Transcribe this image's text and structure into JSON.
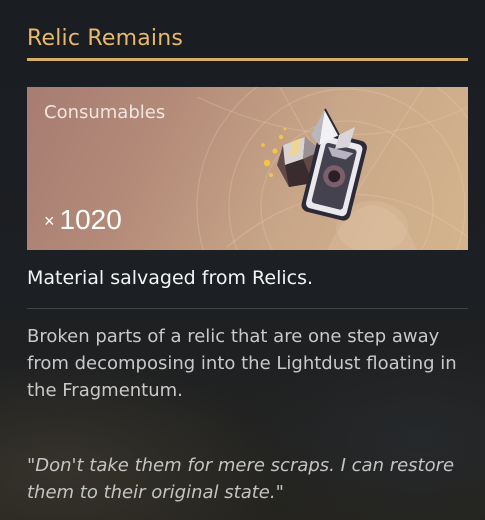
{
  "item": {
    "title": "Relic Remains",
    "category": "Consumables",
    "quantity_prefix": "×",
    "quantity": "1020",
    "icon": "relic-remains-icon",
    "summary": "Material salvaged from Relics.",
    "description": "Broken parts of a relic that are one step away from decomposing into the Lightdust floating in the Fragmentum.",
    "quote": "\"Don't take them for mere scraps. I can restore them to their original state.\""
  },
  "colors": {
    "title": "#e8b96c",
    "rule": "#d9ae6a",
    "card_start": "#a77c72",
    "card_end": "#d4b48e",
    "background": "#1b1e22"
  }
}
